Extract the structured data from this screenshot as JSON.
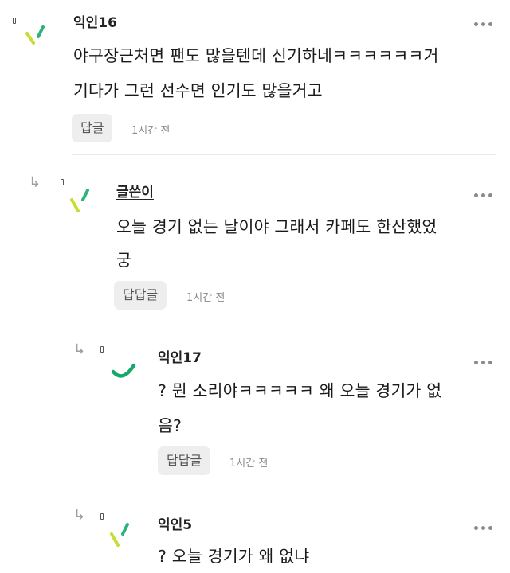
{
  "comments": [
    {
      "author": "익인16",
      "text_line1": "야구장근처면 팬도 많을텐데 신기하네ㅋㅋㅋㅋㅋㅋ거",
      "text_line2": "기다가 그런 선수면 인기도 많을거고",
      "reply_label": "답글",
      "time": "1시간 전",
      "avatar_style": "dash",
      "is_writer": false
    },
    {
      "author": "글쓴이",
      "text_line1": "오늘 경기 없는 날이야 그래서 카페도 한산했었",
      "text_line2": "궁",
      "reply_label": "답답글",
      "time": "1시간 전",
      "avatar_style": "dash",
      "is_writer": true
    },
    {
      "author": "익인17",
      "text_line1": "? 뭔 소리야ㅋㅋㅋㅋㅋ 왜 오늘 경기가 없",
      "text_line2": "음?",
      "reply_label": "답답글",
      "time": "1시간 전",
      "avatar_style": "arc",
      "is_writer": false
    },
    {
      "author": "익인5",
      "text_line1": "? 오늘 경기가 왜 없냐",
      "text_line2": "",
      "reply_label": "",
      "time": "",
      "avatar_style": "dash",
      "is_writer": false
    }
  ],
  "icons": {
    "more": "more-dots-icon",
    "reply": "reply-arrow-icon",
    "menu": "mini-menu-icon"
  },
  "colors": {
    "avatar_lime": "#c8dc32",
    "avatar_green": "#2db37a",
    "avatar_arc": "#18a86b"
  }
}
